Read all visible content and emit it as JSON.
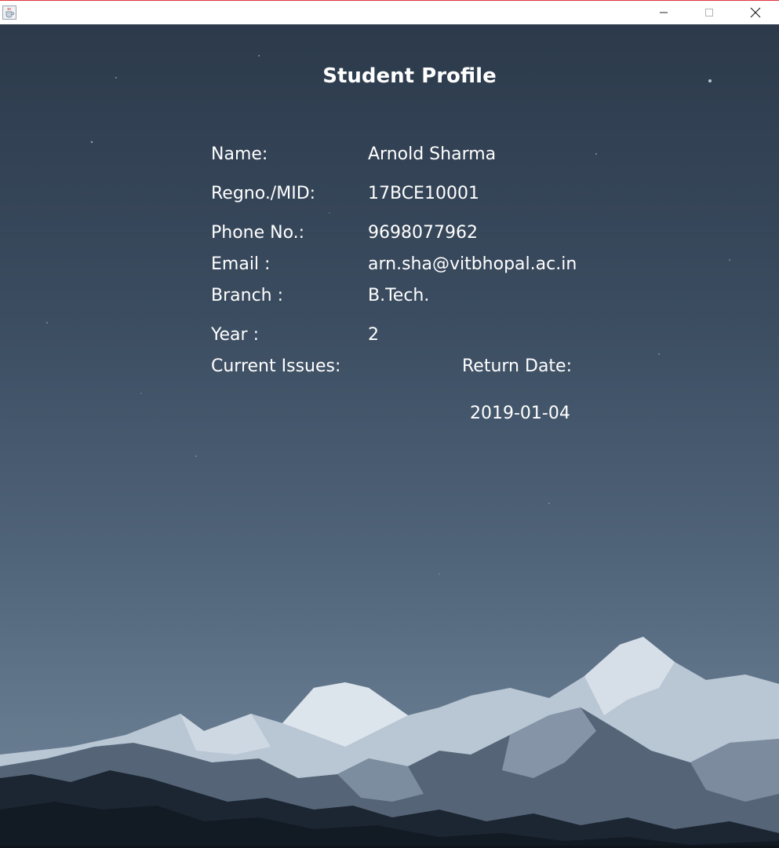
{
  "window": {
    "controls": {
      "minimize_icon": "minimize-icon",
      "maximize_icon": "maximize-icon",
      "close_icon": "close-icon"
    },
    "app_icon": "java-cup-icon"
  },
  "page": {
    "title": "Student Profile"
  },
  "profile": {
    "name_label": "Name:",
    "name_value": "Arnold Sharma",
    "regno_label": "Regno./MID:",
    "regno_value": "17BCE10001",
    "phone_label": "Phone No.:",
    "phone_value": "9698077962",
    "email_label": "Email :",
    "email_value": "arn.sha@vitbhopal.ac.in",
    "branch_label": "Branch :",
    "branch_value": "B.Tech.",
    "year_label": "Year :",
    "year_value": "2",
    "issues_label": "Current Issues:",
    "return_label": "Return Date:",
    "return_dates": [
      "2019-01-04"
    ]
  },
  "colors": {
    "text": "#ffffff",
    "sky_top": "#2c3a4b",
    "sky_bottom": "#6e8196",
    "titlebar_accent": "#e0373f"
  }
}
